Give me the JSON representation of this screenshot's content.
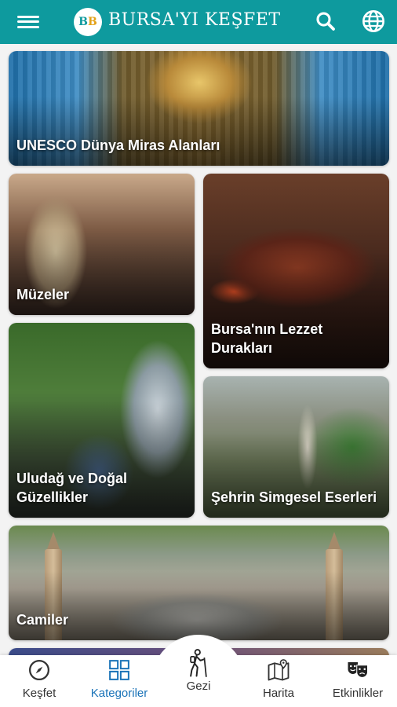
{
  "header": {
    "title": "BURSA'YI KEŞFET",
    "logo_text": "BB"
  },
  "categories": [
    {
      "label": "UNESCO Dünya Miras Alanları"
    },
    {
      "label": "Müzeler"
    },
    {
      "label": "Bursa'nın Lezzet Durakları"
    },
    {
      "label": "Uludağ ve Doğal Güzellikler"
    },
    {
      "label": "Şehrin Simgesel Eserleri"
    },
    {
      "label": "Camiler"
    }
  ],
  "bottom_nav": {
    "items": [
      {
        "label": "Keşfet",
        "icon": "compass-icon"
      },
      {
        "label": "Kategoriler",
        "icon": "grid-icon",
        "active": true
      },
      {
        "label": "Gezi",
        "icon": "hiker-icon"
      },
      {
        "label": "Harita",
        "icon": "map-icon"
      },
      {
        "label": "Etkinlikler",
        "icon": "theater-masks-icon"
      }
    ]
  },
  "colors": {
    "header_bg": "#0e9a9e",
    "active_nav": "#1a73b8"
  }
}
